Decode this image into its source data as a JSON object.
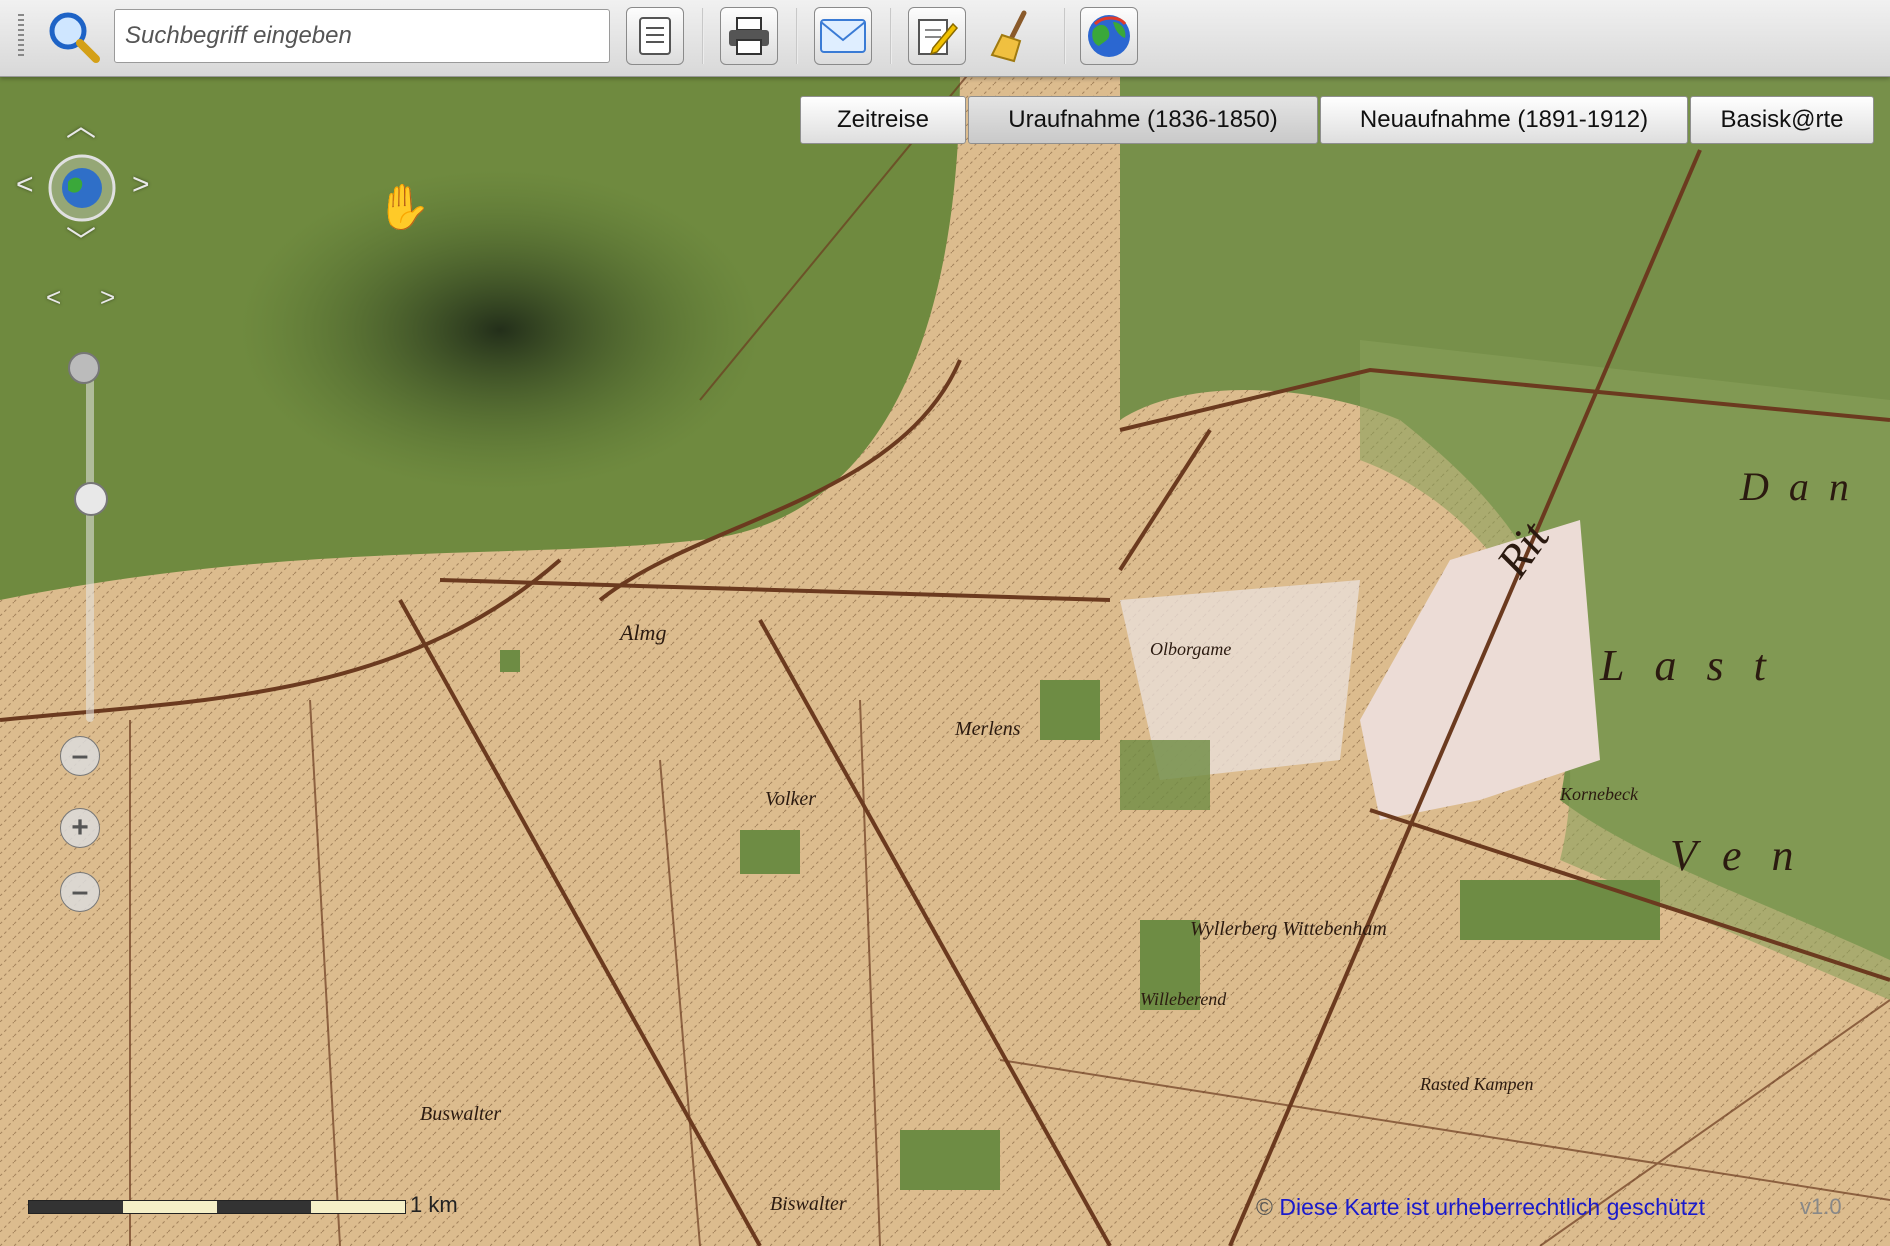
{
  "toolbar": {
    "search_placeholder": "Suchbegriff eingeben",
    "buttons": [
      {
        "name": "search-icon"
      },
      {
        "name": "document-icon"
      },
      {
        "name": "print-icon"
      },
      {
        "name": "mail-icon"
      },
      {
        "name": "edit-icon"
      },
      {
        "name": "broom-icon"
      },
      {
        "name": "globe-icon"
      }
    ]
  },
  "tabs": [
    {
      "label": "Zeitreise",
      "active": false
    },
    {
      "label": "Uraufnahme (1836-1850)",
      "active": true
    },
    {
      "label": "Neuaufnahme (1891-1912)",
      "active": false
    },
    {
      "label": "Basisk@rte",
      "active": false
    }
  ],
  "map": {
    "labels": [
      "Almg",
      "Volker",
      "Merlens",
      "Olborgame",
      "Willeberend",
      "Kornebeck",
      "Buswalter",
      "Biswalter",
      "Rasted Kampen",
      "Wyllerberg Wittebenham",
      "Last",
      "Ven",
      "Rit",
      "Dan"
    ]
  },
  "scale": {
    "label": "1 km"
  },
  "copyright": {
    "symbol": "©",
    "text": "Diese Karte ist urheberrechtlich geschützt"
  },
  "version": "v1.0",
  "colors": {
    "forest": "#6f8a3f",
    "field": "#d9b98a",
    "road": "#6b3a1f",
    "link": "#1a1acc"
  }
}
